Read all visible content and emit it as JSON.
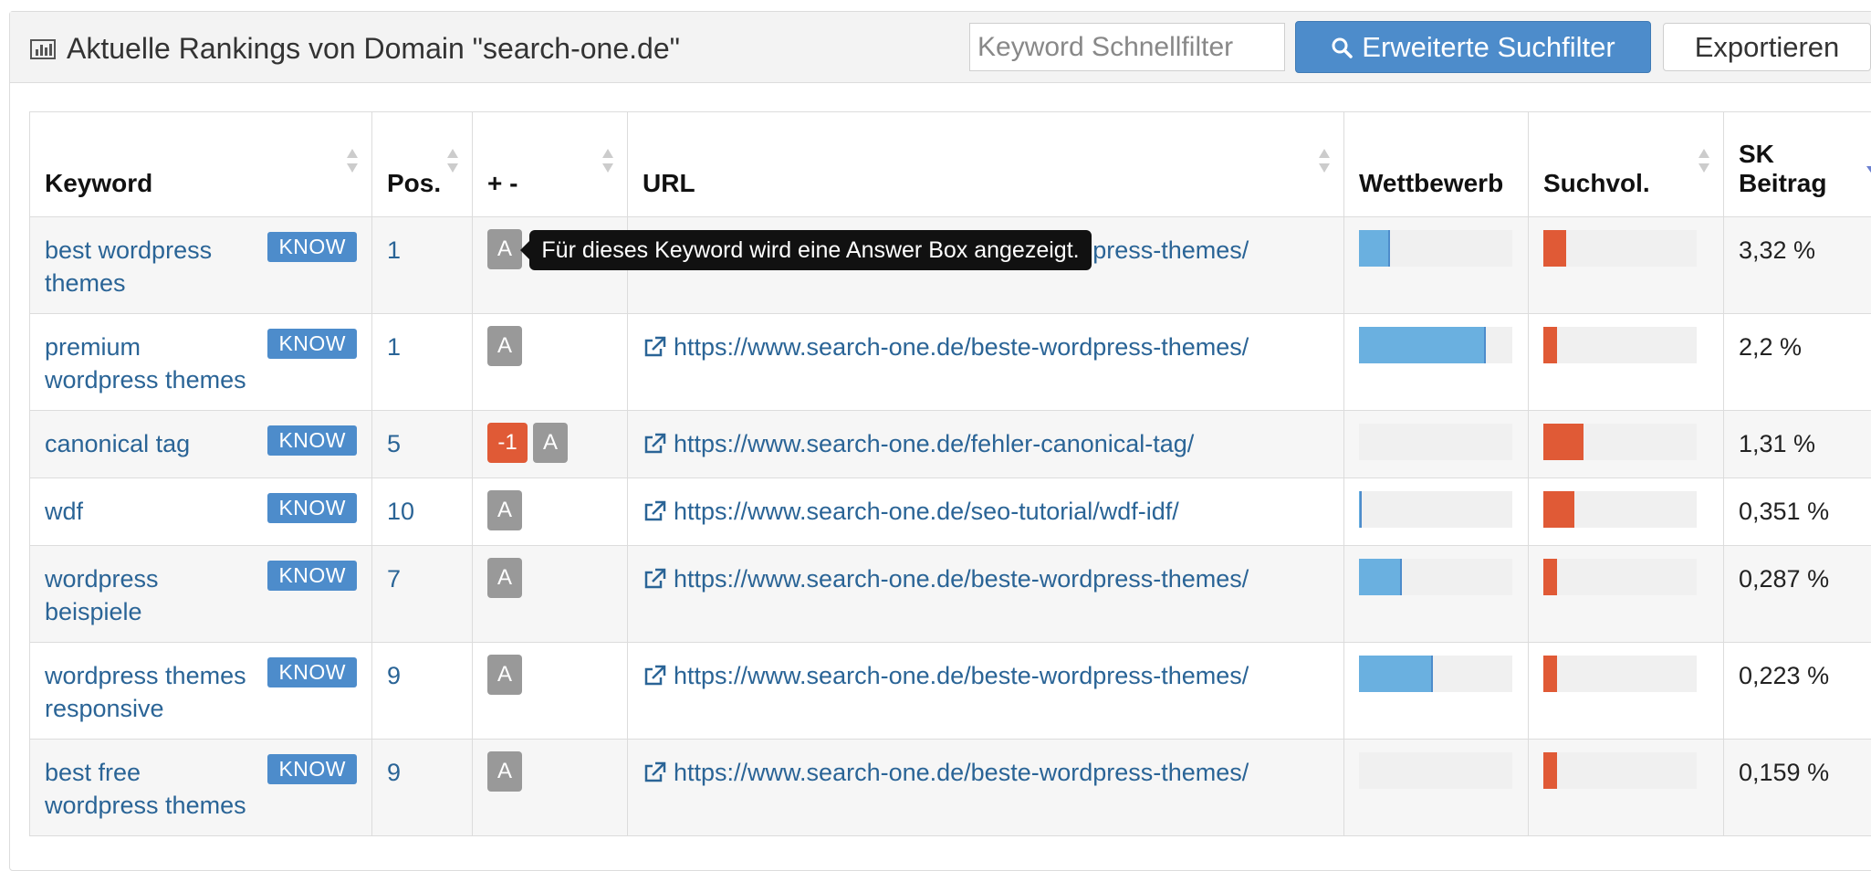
{
  "header": {
    "title": "Aktuelle Rankings von Domain \"search-one.de\"",
    "quick_filter_placeholder": "Keyword Schnellfilter",
    "advanced_filter_label": "Erweiterte Suchfilter",
    "export_label": "Exportieren"
  },
  "columns": {
    "keyword": "Keyword",
    "position": "Pos.",
    "change": "+ -",
    "url": "URL",
    "competition": "Wettbewerb",
    "search_volume": "Suchvol.",
    "sk_line1": "SK",
    "sk_line2": "Beitrag"
  },
  "rows": [
    {
      "keyword": "best wordpress themes",
      "intent": "KNOW",
      "position": "1",
      "change": "",
      "badge": "A",
      "url": "https://www.search-one.de/beste-wordpress-themes/",
      "competition": 0.2,
      "search_volume": 0.15,
      "share": "3,32 %"
    },
    {
      "keyword": "premium wordpress themes",
      "intent": "KNOW",
      "position": "1",
      "change": "",
      "badge": "A",
      "url": "https://www.search-one.de/beste-wordpress-themes/",
      "competition": 0.83,
      "search_volume": 0.09,
      "share": "2,2 %"
    },
    {
      "keyword": "canonical tag",
      "intent": "KNOW",
      "position": "5",
      "change": "-1",
      "badge": "A",
      "url": "https://www.search-one.de/fehler-canonical-tag/",
      "competition": 0.0,
      "search_volume": 0.26,
      "share": "1,31 %"
    },
    {
      "keyword": "wdf",
      "intent": "KNOW",
      "position": "10",
      "change": "",
      "badge": "A",
      "url": "https://www.search-one.de/seo-tutorial/wdf-idf/",
      "competition": 0.01,
      "search_volume": 0.2,
      "share": "0,351 %"
    },
    {
      "keyword": "wordpress beispiele",
      "intent": "KNOW",
      "position": "7",
      "change": "",
      "badge": "A",
      "url": "https://www.search-one.de/beste-wordpress-themes/",
      "competition": 0.28,
      "search_volume": 0.09,
      "share": "0,287 %"
    },
    {
      "keyword": "wordpress themes responsive",
      "intent": "KNOW",
      "position": "9",
      "change": "",
      "badge": "A",
      "url": "https://www.search-one.de/beste-wordpress-themes/",
      "competition": 0.48,
      "search_volume": 0.09,
      "share": "0,223 %"
    },
    {
      "keyword": "best free wordpress themes",
      "intent": "KNOW",
      "position": "9",
      "change": "",
      "badge": "A",
      "url": "https://www.search-one.de/beste-wordpress-themes/",
      "competition": 0.0,
      "search_volume": 0.09,
      "share": "0,159 %"
    }
  ],
  "tooltip": {
    "text": "Für dieses Keyword wird eine Answer Box angezeigt."
  },
  "colors": {
    "primary": "#4d8ccb",
    "competition_bar": "#6ab0e0",
    "search_volume_bar": "#e05a36",
    "link": "#2a6496"
  }
}
